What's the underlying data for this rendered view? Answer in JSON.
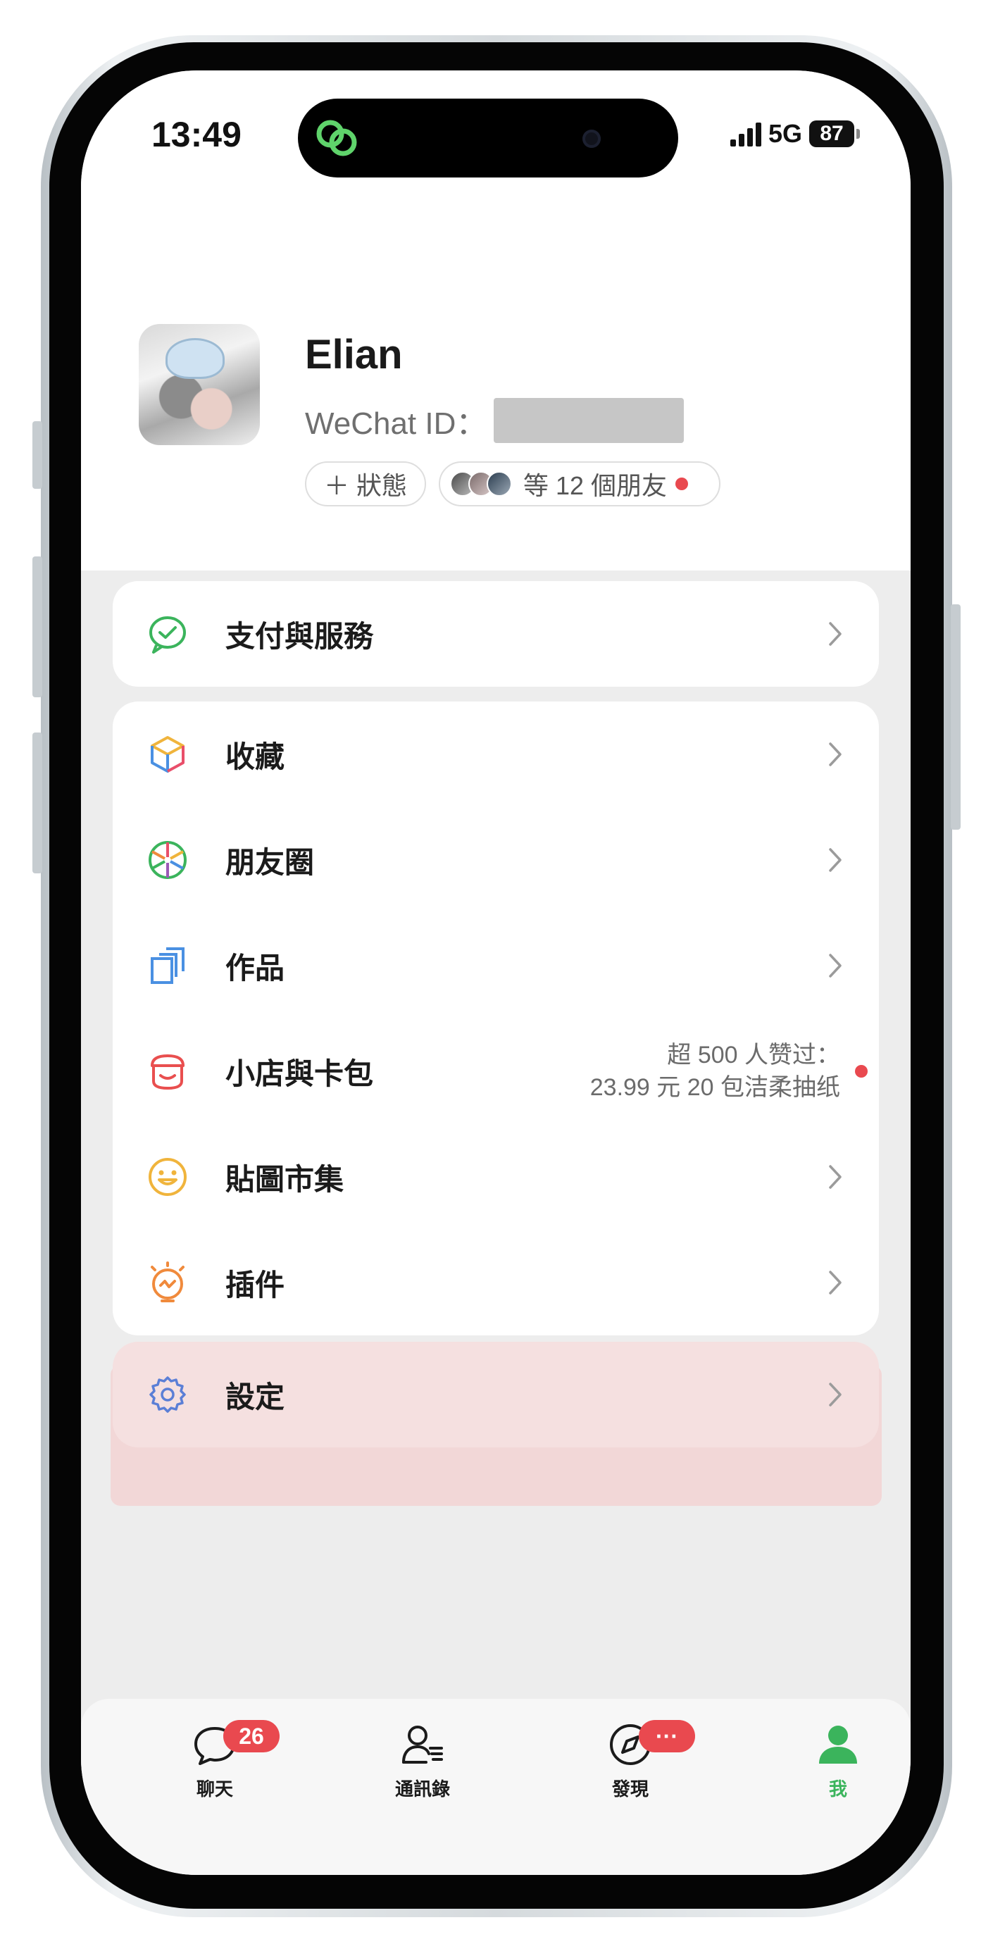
{
  "status_bar": {
    "time": "13:49",
    "network": "5G",
    "battery": "87"
  },
  "profile": {
    "name": "Elian",
    "wechat_id_label": "WeChat ID：",
    "status_chip": "＋ 狀態",
    "friends_chip": "等 12 個朋友"
  },
  "menu": {
    "pay": {
      "label": "支付與服務"
    },
    "items": [
      {
        "label": "收藏"
      },
      {
        "label": "朋友圈"
      },
      {
        "label": "作品"
      },
      {
        "label": "小店與卡包",
        "promo_line1": "超 500 人赞过：",
        "promo_line2": "23.99 元 20 包洁柔抽纸"
      },
      {
        "label": "貼圖市集"
      },
      {
        "label": "插件"
      }
    ],
    "settings": {
      "label": "設定"
    }
  },
  "tabbar": {
    "tabs": [
      {
        "label": "聊天",
        "badge": "26"
      },
      {
        "label": "通訊錄"
      },
      {
        "label": "發現",
        "badge": "···"
      },
      {
        "label": "我"
      }
    ]
  },
  "colors": {
    "accent_green": "#3bb45c",
    "badge_red": "#e9494f",
    "highlight_pink": "#f2d7d7"
  }
}
